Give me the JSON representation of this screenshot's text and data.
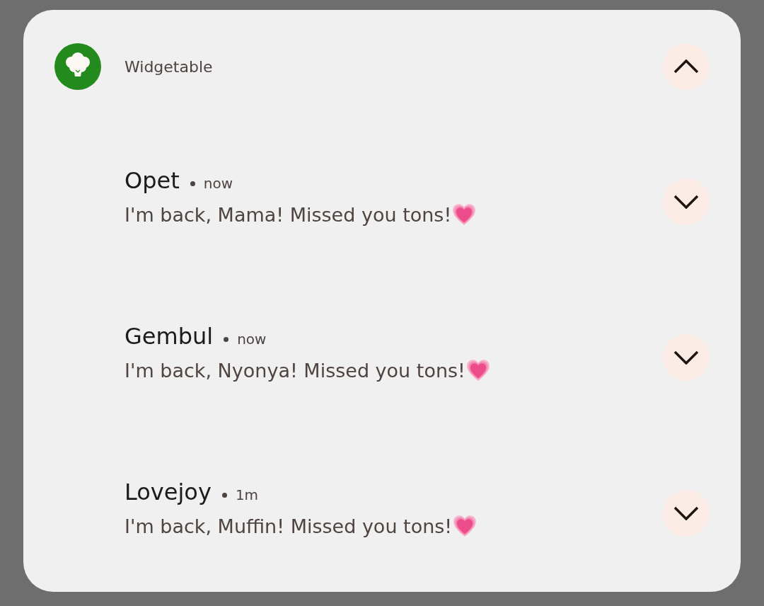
{
  "app": {
    "name": "Widgetable",
    "expanded": true
  },
  "notifications": [
    {
      "sender": "Opet",
      "time": "now",
      "message": "I'm back, Mama! Missed you tons!",
      "expanded": false
    },
    {
      "sender": "Gembul",
      "time": "now",
      "message": "I'm back, Nyonya! Missed you tons!",
      "expanded": false
    },
    {
      "sender": "Lovejoy",
      "time": "1m",
      "message": "I'm back, Muffin! Missed you tons!",
      "expanded": false
    }
  ]
}
